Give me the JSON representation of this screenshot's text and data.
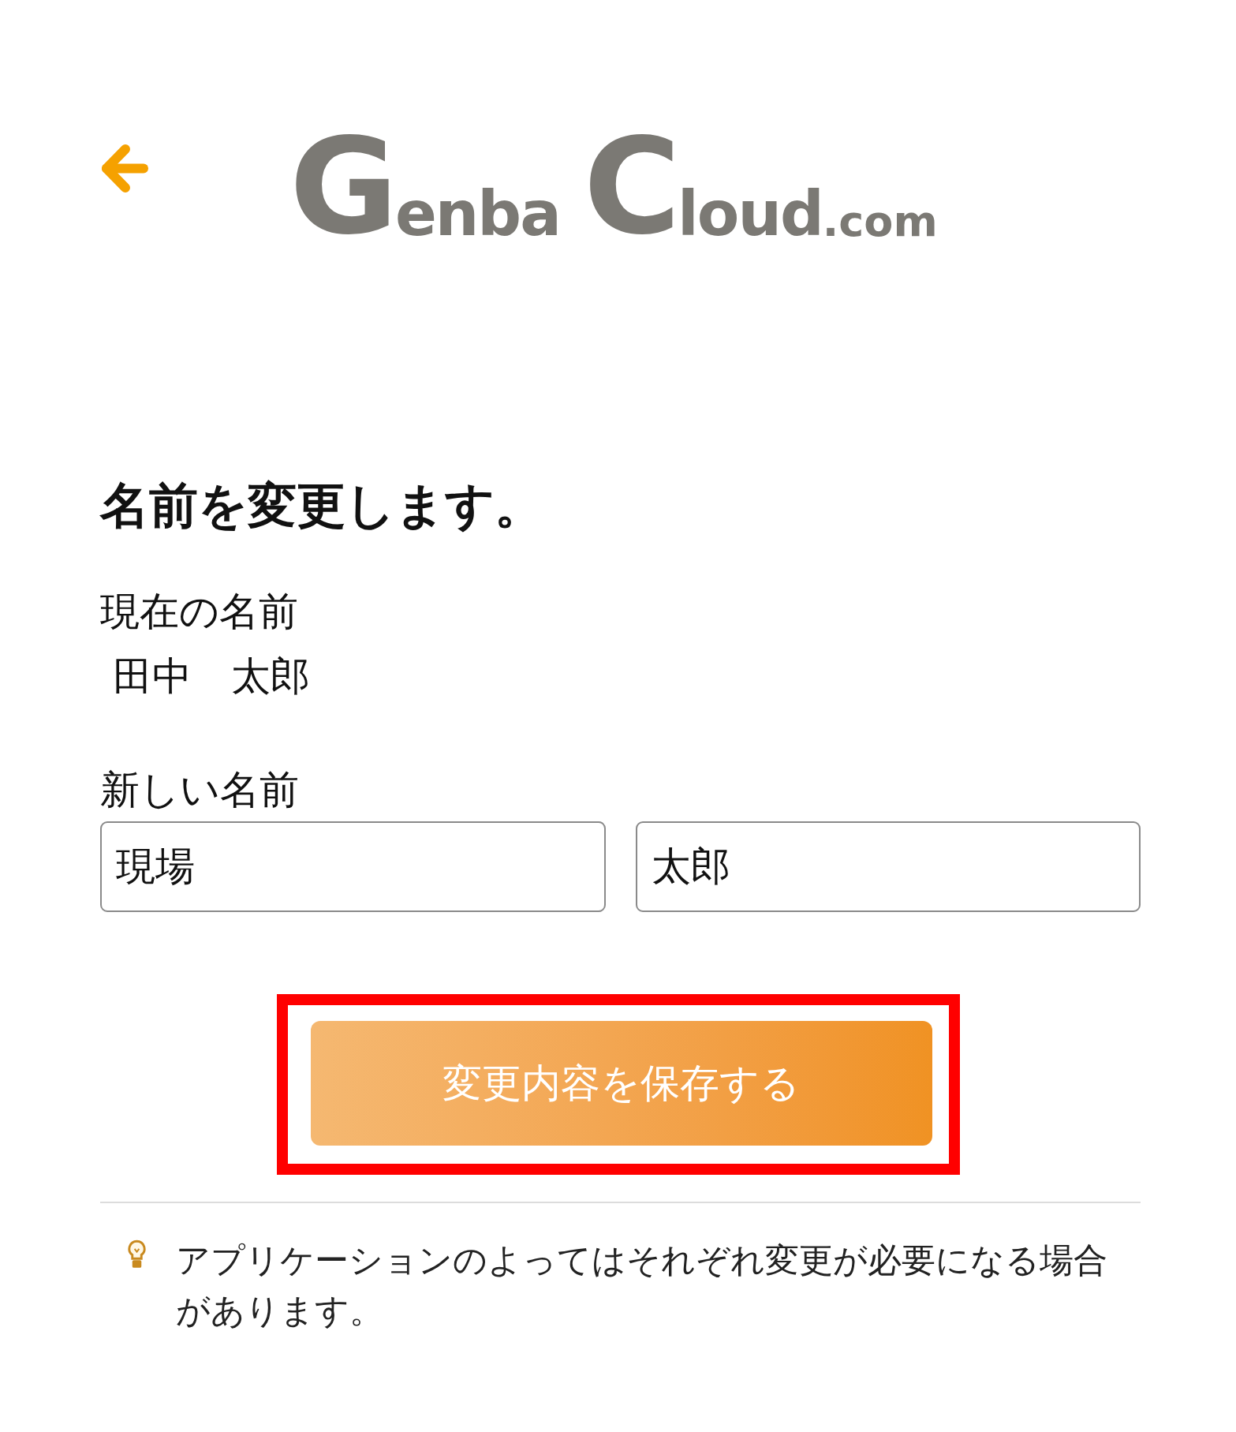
{
  "logo": {
    "words": [
      {
        "initial": "G",
        "body": "enba"
      },
      {
        "initial": "C",
        "body": "loud",
        "suffix": ".com"
      }
    ]
  },
  "title": "名前を変更します。",
  "current_name": {
    "label": "現在の名前",
    "value": "田中　太郎"
  },
  "new_name": {
    "label": "新しい名前",
    "fields": [
      {
        "value": "現場"
      },
      {
        "value": "太郎"
      }
    ]
  },
  "save_button": {
    "label": "変更内容を保存する",
    "highlighted": true
  },
  "note": {
    "text": "アプリケーションのよってはそれぞれ変更が必要になる場合があります。"
  }
}
